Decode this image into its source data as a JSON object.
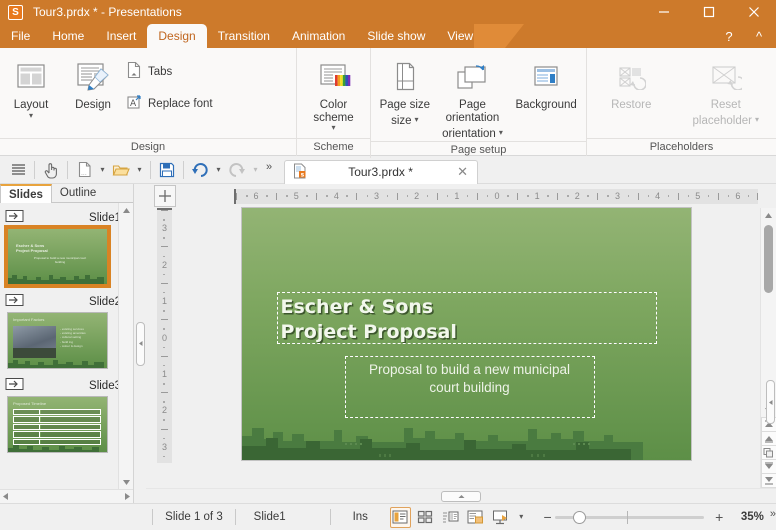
{
  "window": {
    "title": "Tour3.prdx * - Presentations",
    "logo_letter": "S",
    "minimize": "minimize-button",
    "maximize": "maximize-button",
    "close": "close-button",
    "help": "?",
    "collapse_ribbon": "^",
    "accent_color": "#cd7a2b"
  },
  "menu": {
    "tabs": [
      {
        "label": "File",
        "active": false
      },
      {
        "label": "Home",
        "active": false
      },
      {
        "label": "Insert",
        "active": false
      },
      {
        "label": "Design",
        "active": true
      },
      {
        "label": "Transition",
        "active": false
      },
      {
        "label": "Animation",
        "active": false
      },
      {
        "label": "Slide show",
        "active": false
      },
      {
        "label": "View",
        "active": false
      }
    ]
  },
  "ribbon": {
    "groups": [
      {
        "title": "Design",
        "big_buttons": [
          {
            "label": "Layout",
            "icon": "layout-icon",
            "has_caret": true,
            "disabled": false
          },
          {
            "label": "Design",
            "icon": "design-brush-icon",
            "has_caret": false,
            "disabled": false
          }
        ],
        "small_buttons": [
          {
            "label": "Tabs",
            "icon": "tabs-icon"
          },
          {
            "label": "Replace font",
            "icon": "replace-font-icon"
          }
        ]
      },
      {
        "title": "Scheme",
        "big_buttons": [
          {
            "label": "Color scheme",
            "icon": "color-scheme-icon",
            "has_caret": true,
            "disabled": false
          }
        ],
        "small_buttons": []
      },
      {
        "title": "Page setup",
        "big_buttons": [
          {
            "label": "Page size",
            "icon": "page-size-icon",
            "has_caret": true,
            "disabled": false
          },
          {
            "label": "Page orientation",
            "icon": "page-orientation-icon",
            "has_caret": true,
            "disabled": false
          },
          {
            "label": "Background",
            "icon": "background-icon",
            "has_caret": false,
            "disabled": false
          }
        ],
        "small_buttons": []
      },
      {
        "title": "Placeholders",
        "big_buttons": [
          {
            "label": "Restore",
            "icon": "restore-placeholder-icon",
            "has_caret": false,
            "disabled": true
          },
          {
            "label": "Reset placeholder",
            "icon": "reset-placeholder-icon",
            "has_caret": true,
            "disabled": true
          }
        ],
        "small_buttons": []
      }
    ]
  },
  "quick_access": {
    "buttons": [
      {
        "name": "menu-icon"
      },
      {
        "name": "touch-mode-icon"
      },
      {
        "name": "new-document-icon"
      },
      {
        "name": "open-folder-icon"
      },
      {
        "name": "save-icon"
      },
      {
        "name": "undo-icon"
      },
      {
        "name": "redo-icon"
      }
    ],
    "overflow_label": "»"
  },
  "document_tab": {
    "name": "Tour3.prdx *",
    "close_label": "✕",
    "icon": "presentation-file-icon"
  },
  "slide_panel": {
    "tabs": [
      {
        "label": "Slides",
        "active": true
      },
      {
        "label": "Outline",
        "active": false
      }
    ],
    "slides": [
      {
        "label": "Slide1",
        "selected": true,
        "kind": "title"
      },
      {
        "label": "Slide2",
        "selected": false,
        "kind": "picture"
      },
      {
        "label": "Slide3",
        "selected": false,
        "kind": "table"
      }
    ]
  },
  "rulers": {
    "horizontal_ticks": [
      "6",
      "5",
      "4",
      "3",
      "2",
      "1",
      "0",
      "1",
      "2",
      "3",
      "4",
      "5",
      "6"
    ],
    "vertical_ticks": [
      "3",
      "2",
      "1",
      "0",
      "1",
      "2",
      "3"
    ]
  },
  "slide": {
    "title_line1": "Escher & Sons",
    "title_line2": "Project Proposal",
    "subtitle_line1": "Proposal to build a new municipal",
    "subtitle_line2": "court building",
    "background_top": "#93b474",
    "background_bottom": "#5d8f47",
    "city_color": "#41713a"
  },
  "status_bar": {
    "slide_count": "Slide 1 of 3",
    "layout_name": "Slide1",
    "insert_mode": "Ins",
    "view_buttons": [
      {
        "name": "normal-view-button",
        "active": true
      },
      {
        "name": "slide-sorter-view-button",
        "active": false
      },
      {
        "name": "outline-view-button",
        "active": false
      },
      {
        "name": "notes-view-button",
        "active": false
      },
      {
        "name": "start-slideshow-button",
        "active": false
      }
    ],
    "slideshow_caret": "▾",
    "zoom_out": "−",
    "zoom_in": "+",
    "zoom_level": "35%",
    "overflow": "»"
  }
}
